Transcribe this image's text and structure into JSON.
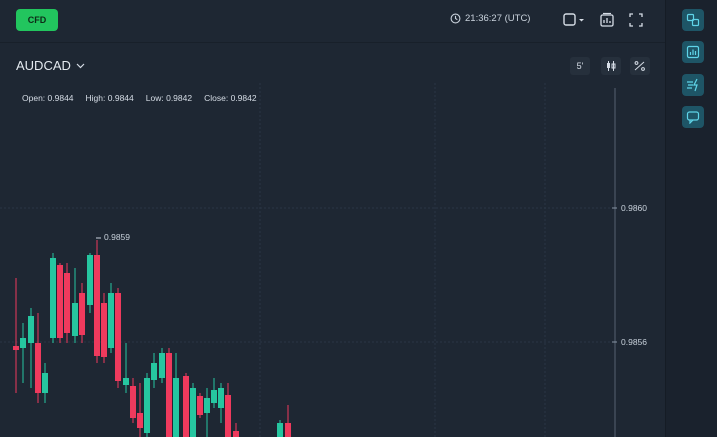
{
  "topbar": {
    "market_button": "CFD",
    "clock": "21:36:27 (UTC)"
  },
  "chart": {
    "symbol": "AUDCAD",
    "interval": "5'",
    "ohlc": {
      "open_label": "Open:",
      "open": "0.9844",
      "high_label": "High:",
      "high": "0.9844",
      "low_label": "Low:",
      "low": "0.9842",
      "close_label": "Close:",
      "close": "0.9842"
    },
    "price_labels": [
      "0.9860",
      "0.9856"
    ],
    "high_marker": "0.9859"
  },
  "colors": {
    "background": "#1e2733",
    "up": "#26c6a0",
    "down": "#ef3a5d",
    "grid": "#2a3644",
    "accent": "#22c55e",
    "sidebar_button": "#1e5566"
  },
  "icons": {
    "clock": "clock-icon",
    "layout": "square-layout-icon",
    "indicators": "indicators-icon",
    "fullscreen": "fullscreen-icon",
    "candle_type": "candle-type-icon",
    "draw": "drawing-tools-icon"
  },
  "sidebar_icons": [
    "swap-icon",
    "chart-panel-icon",
    "fast-trade-icon",
    "chat-icon"
  ]
}
